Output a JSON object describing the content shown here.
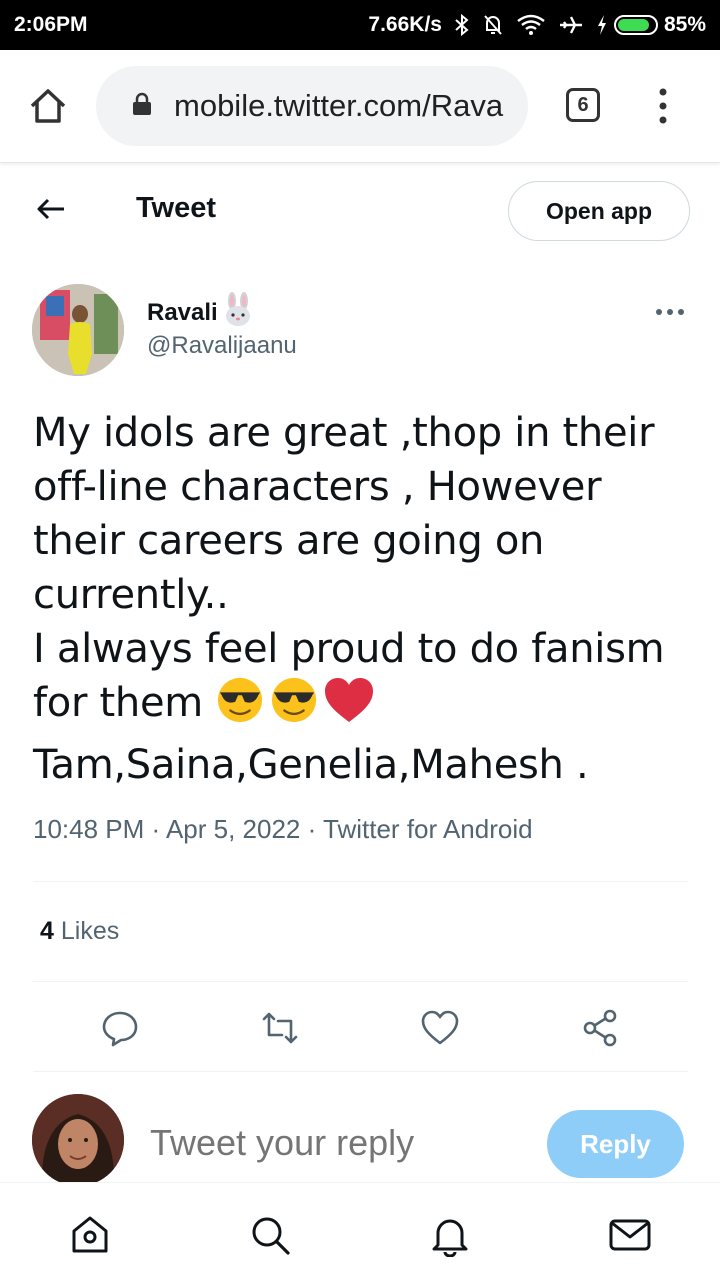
{
  "status_bar": {
    "time": "2:06PM",
    "network_speed": "7.66K/s",
    "battery": "85%",
    "battery_level": 0.85,
    "icons": [
      "bluetooth-icon",
      "muted-bell-icon",
      "wifi-icon",
      "airplane-icon",
      "charging-icon",
      "battery-icon"
    ]
  },
  "browser": {
    "url": "mobile.twitter.com/Ravalijaanu",
    "tab_count": "6"
  },
  "header": {
    "title": "Tweet",
    "open_app": "Open app"
  },
  "author": {
    "name": "Ravali",
    "handle": "@Ravalijaanu",
    "name_emoji": "🐰"
  },
  "tweet": {
    "text_line1": "My idols are great ,thop in their off-line characters , However their careers are going on currently..",
    "text_line2": "I always feel proud to do fanism for them",
    "text_line3": "Tam,Saina,Genelia,Mahesh .",
    "timestamp": "10:48 PM · Apr 5, 2022 · Twitter for Android"
  },
  "stats": {
    "likes_count": "4",
    "likes_label": "Likes"
  },
  "reply": {
    "placeholder": "Tweet your reply",
    "button": "Reply"
  },
  "colors": {
    "accent": "#1d9bf0",
    "reply_button_disabled": "#8ecdf8",
    "secondary_text": "#536471"
  }
}
